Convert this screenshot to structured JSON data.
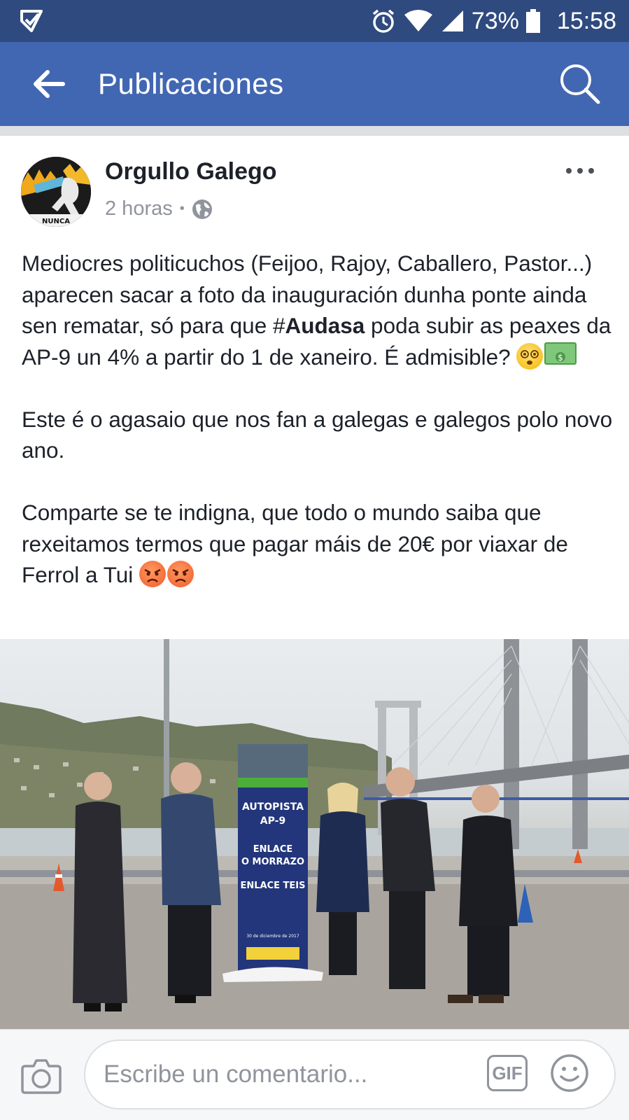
{
  "status_bar": {
    "battery": "73%",
    "time": "15:58"
  },
  "toolbar": {
    "title": "Publicaciones"
  },
  "post": {
    "author": "Orgullo Galego",
    "time": "2 horas",
    "separator": "•",
    "avatar_text": "NUNCA",
    "paragraph1_part1": "Mediocres politicuchos (Feijoo, Rajoy, Caballero, Pastor...) aparecen sacar a foto da inauguración dunha ponte ainda sen rematar, só para que ",
    "hashtag_prefix": "#",
    "hashtag_word": "Audasa",
    "paragraph1_part2": " poda subir as peaxes da AP-9 un 4% a partir do 1 de xaneiro. É admisible? ",
    "paragraph2": "Este é o agasaio que nos fan a galegas e galegos polo novo ano.",
    "paragraph3": "Comparte se te indigna, que todo o mundo saiba que rexeitamos termos que pagar máis de 20€ por viaxar de Ferrol a Tui "
  },
  "photo": {
    "sign_line1": "AUTOPISTA",
    "sign_line2": "AP-9",
    "sign_line3": "ENLACE",
    "sign_line4": "O MORRAZO",
    "sign_line5": "ENLACE TEIS",
    "sign_date": "30 de diciembre de 2017"
  },
  "comment_bar": {
    "placeholder": "Escribe un comentario...",
    "gif_label": "GIF"
  },
  "colors": {
    "status_bar": "#2f4a7f",
    "toolbar": "#4267b2",
    "secondary_text": "#90949c"
  },
  "icons": [
    "messenger-notification-icon",
    "alarm-icon",
    "wifi-icon",
    "signal-icon",
    "battery-icon",
    "back-arrow-icon",
    "search-icon",
    "globe-icon",
    "more-options-icon",
    "dizzy-face-emoji",
    "money-emoji",
    "angry-face-emoji",
    "camera-icon",
    "gif-icon",
    "smiley-icon"
  ]
}
